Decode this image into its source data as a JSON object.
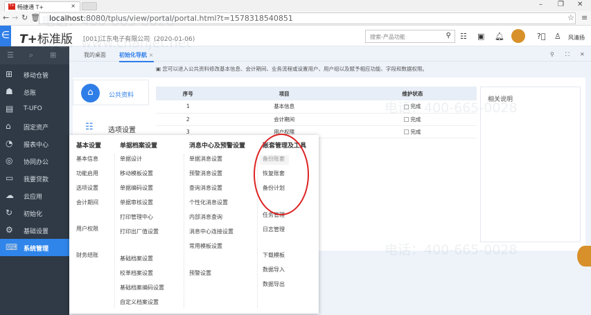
{
  "browser": {
    "tab_title": "畅捷通 T+",
    "tab_favicon": "T+",
    "url_host": "localhost",
    "url_rest": ":8080/tplus/view/portal/portal.html?t=1578318540851"
  },
  "header": {
    "logo": "T+",
    "edition": "标准版",
    "company": "[001]江东电子有限公司",
    "date": "(2020-01-06)",
    "search_placeholder": "搜索-产品功能",
    "user": "风清扬"
  },
  "sidebar": {
    "items": [
      {
        "label": "移动仓管",
        "icon": "mobile-warehouse-icon"
      },
      {
        "label": "总账",
        "icon": "ledger-icon"
      },
      {
        "label": "T-UFO",
        "icon": "ufo-icon"
      },
      {
        "label": "固定资产",
        "icon": "bank-icon"
      },
      {
        "label": "报表中心",
        "icon": "pie-chart-icon"
      },
      {
        "label": "协同办公",
        "icon": "collab-icon"
      },
      {
        "label": "我要贷款",
        "icon": "money-icon"
      },
      {
        "label": "云应用",
        "icon": "cloud-icon"
      },
      {
        "label": "初始化",
        "icon": "refresh-icon"
      },
      {
        "label": "基础设置",
        "icon": "settings-icon"
      },
      {
        "label": "系统管理",
        "icon": "monitor-code-icon"
      }
    ],
    "active": 10
  },
  "tabs": [
    {
      "label": "我的桌面"
    },
    {
      "label": "初始化导航"
    }
  ],
  "info": "您可以进入公共资料修改基本信息、会计期间、业务流程或设置用户、用户组以及赋予相应功能、字段和数据权限。",
  "left": {
    "public": "公共资料",
    "options": "选项设置"
  },
  "table": {
    "headers": [
      "序号",
      "项目",
      "维护状态"
    ],
    "rows": [
      {
        "no": "1",
        "item": "基本信息",
        "status": "完成"
      },
      {
        "no": "2",
        "item": "会计期间",
        "status": "完成"
      },
      {
        "no": "3",
        "item": "用户权限",
        "status": "完成"
      }
    ]
  },
  "right_panel": {
    "title": "相关说明"
  },
  "menu": {
    "columns": [
      {
        "title": "基本设置",
        "items": [
          "基本信息",
          "功能启用",
          "选项设置",
          "会计期间",
          "用户权限",
          "财务结账"
        ]
      },
      {
        "title": "单据档案设置",
        "items": [
          "单据设计",
          "移动模板设置",
          "单据编码设置",
          "单据审核设置",
          "打印管理中心",
          "打印出厂值设置",
          "基础档案设置",
          "校革档案设置",
          "基础档案编码设置",
          "自定义档案设置"
        ]
      },
      {
        "title": "消息中心及预警设置",
        "items": [
          "单据消息设置",
          "预警消息设置",
          "查询消息设置",
          "个性化消息设置",
          "内部消息查询",
          "消息中心连接设置",
          "常用模板设置",
          "预警设置"
        ]
      },
      {
        "title": "账套管理及工具",
        "items": [
          "备份账套",
          "恢复账套",
          "备份计划",
          "任务管理",
          "日志管理",
          "下载模板",
          "数据导入",
          "数据导出"
        ]
      }
    ]
  },
  "watermark": {
    "phone": "电话：400-665-0028",
    "site": "网址：www.chanjet.net"
  }
}
